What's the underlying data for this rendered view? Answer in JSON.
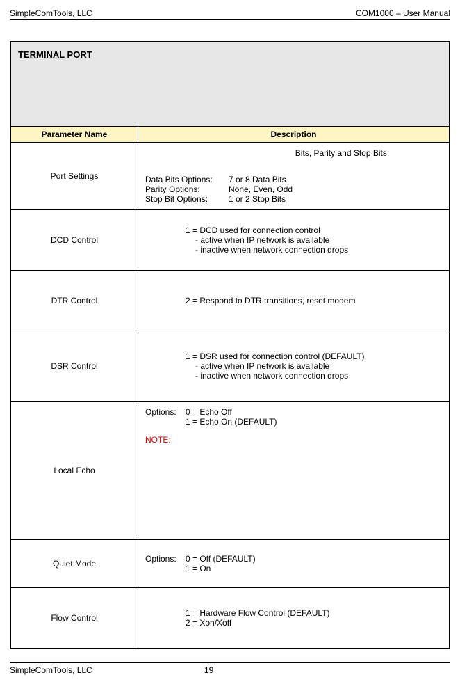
{
  "header": {
    "left": "SimpleComTools, LLC",
    "right": "COM1000 – User Manual"
  },
  "table": {
    "title": "TERMINAL PORT",
    "col1": "Parameter Name",
    "col2": "Description",
    "rows": {
      "portSettings": {
        "name": "Port Settings",
        "topLine": "Bits, Parity and Stop Bits.",
        "l1a": "Data Bits Options:",
        "l1b": "7 or 8 Data Bits",
        "l2a": "Parity Options:",
        "l2b": "None, Even, Odd",
        "l3a": "Stop Bit Options:",
        "l3b": "1 or 2 Stop Bits"
      },
      "dcd": {
        "name": "DCD Control",
        "ln1": "1 = DCD used for connection control",
        "ln2": "- active when IP network is available",
        "ln3": "- inactive when network connection drops"
      },
      "dtr": {
        "name": "DTR Control",
        "ln1": "2 = Respond to DTR transitions, reset modem"
      },
      "dsr": {
        "name": "DSR Control",
        "ln1": "1 = DSR used for connection control (DEFAULT)",
        "ln2": "- active when IP network is available",
        "ln3": "- inactive when network connection drops"
      },
      "echo": {
        "name": "Local Echo",
        "optLabel": "Options:",
        "opt1": "0 = Echo Off",
        "opt2": "1 = Echo On (DEFAULT)",
        "note": "NOTE:"
      },
      "quiet": {
        "name": "Quiet Mode",
        "optLabel": "Options:",
        "opt1": "0 = Off (DEFAULT)",
        "opt2": "1 = On"
      },
      "flow": {
        "name": "Flow Control",
        "ln1": "1 = Hardware Flow Control (DEFAULT)",
        "ln2": "2 = Xon/Xoff"
      }
    }
  },
  "footer": {
    "left": "SimpleComTools, LLC",
    "page": "19"
  }
}
